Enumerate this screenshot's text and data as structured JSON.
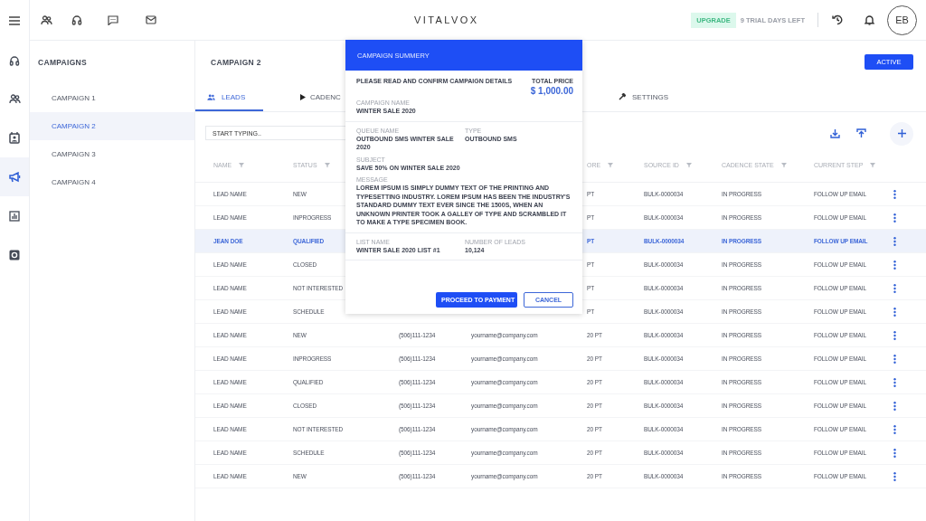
{
  "topbar": {
    "logo": "VITALVOX",
    "upgrade": "UPGRADE",
    "trial": "9 TRIAL DAYS LEFT",
    "avatar": "EB"
  },
  "nav_rail": {
    "items": [
      {
        "selected": false
      },
      {
        "selected": false
      },
      {
        "selected": false
      },
      {
        "selected": true
      },
      {
        "selected": false
      },
      {
        "selected": false
      }
    ]
  },
  "sidebar": {
    "title": "CAMPAIGNS",
    "items": [
      {
        "label": "CAMPAIGN 1",
        "selected": false
      },
      {
        "label": "CAMPAIGN 2",
        "selected": true
      },
      {
        "label": "CAMPAIGN 3",
        "selected": false
      },
      {
        "label": "CAMPAIGN 4",
        "selected": false
      }
    ]
  },
  "main": {
    "title": "CAMPAIGN 2",
    "status_button": "ACTIVE"
  },
  "tabs": [
    {
      "label": "LEADS",
      "selected": true
    },
    {
      "label": "CADENC",
      "selected": false
    },
    {
      "label": "SETTINGS",
      "selected": false
    }
  ],
  "search": {
    "placeholder": "START TYPING.."
  },
  "table": {
    "columns": [
      {
        "label": "NAME"
      },
      {
        "label": "STATUS"
      },
      {},
      {},
      {
        "label": "ORE"
      },
      {
        "label": "SOURCE ID"
      },
      {
        "label": "CADENCE STATE"
      },
      {
        "label": "CURRENT STEP"
      }
    ],
    "rows": [
      {
        "selected": false,
        "cells": [
          "LEAD NAME",
          "NEW",
          null,
          null,
          "PT",
          "BULK-0000034",
          "IN PROGRESS",
          "FOLLOW UP EMAIL"
        ]
      },
      {
        "selected": false,
        "cells": [
          "LEAD NAME",
          "INPROGRESS",
          null,
          null,
          "PT",
          "BULK-0000034",
          "IN PROGRESS",
          "FOLLOW UP EMAIL"
        ]
      },
      {
        "selected": true,
        "cells": [
          "JEAN DOE",
          "QUALIFIED",
          null,
          null,
          "PT",
          "BULK-0000034",
          "IN PROGRESS",
          "FOLLOW UP EMAIL"
        ]
      },
      {
        "selected": false,
        "cells": [
          "LEAD NAME",
          "CLOSED",
          null,
          null,
          "PT",
          "BULK-0000034",
          "IN PROGRESS",
          "FOLLOW UP EMAIL"
        ]
      },
      {
        "selected": false,
        "cells": [
          "LEAD NAME",
          "NOT INTERESTED",
          null,
          null,
          "PT",
          "BULK-0000034",
          "IN PROGRESS",
          "FOLLOW UP EMAIL"
        ]
      },
      {
        "selected": false,
        "cells": [
          "LEAD NAME",
          "SCHEDULE",
          null,
          null,
          "PT",
          "BULK-0000034",
          "IN PROGRESS",
          "FOLLOW UP EMAIL"
        ]
      },
      {
        "selected": false,
        "cells": [
          "LEAD NAME",
          "NEW",
          "(506)111-1234",
          "yourname@company.com",
          "20 PT",
          "BULK-0000034",
          "IN PROGRESS",
          "FOLLOW UP EMAIL"
        ]
      },
      {
        "selected": false,
        "cells": [
          "LEAD NAME",
          "INPROGRESS",
          "(506)111-1234",
          "yourname@company.com",
          "20 PT",
          "BULK-0000034",
          "IN PROGRESS",
          "FOLLOW UP EMAIL"
        ]
      },
      {
        "selected": false,
        "cells": [
          "LEAD NAME",
          "QUALIFIED",
          "(506)111-1234",
          "yourname@company.com",
          "20 PT",
          "BULK-0000034",
          "IN PROGRESS",
          "FOLLOW UP EMAIL"
        ]
      },
      {
        "selected": false,
        "cells": [
          "LEAD NAME",
          "CLOSED",
          "(506)111-1234",
          "yourname@company.com",
          "20 PT",
          "BULK-0000034",
          "IN PROGRESS",
          "FOLLOW UP EMAIL"
        ]
      },
      {
        "selected": false,
        "cells": [
          "LEAD NAME",
          "NOT INTERESTED",
          "(506)111-1234",
          "yourname@company.com",
          "20 PT",
          "BULK-0000034",
          "IN PROGRESS",
          "FOLLOW UP EMAIL"
        ]
      },
      {
        "selected": false,
        "cells": [
          "LEAD NAME",
          "SCHEDULE",
          "(506)111-1234",
          "yourname@company.com",
          "20 PT",
          "BULK-0000034",
          "IN PROGRESS",
          "FOLLOW UP EMAIL"
        ]
      },
      {
        "selected": false,
        "cells": [
          "LEAD NAME",
          "NEW",
          "(506)111-1234",
          "yourname@company.com",
          "20 PT",
          "BULK-0000034",
          "IN PROGRESS",
          "FOLLOW UP EMAIL"
        ]
      }
    ]
  },
  "modal": {
    "title": "CAMPAIGN SUMMERY",
    "intro": "PLEASE READ AND CONFIRM CAMPAIGN DETAILS",
    "price_label": "TOTAL PRICE",
    "price": "$ 1,000.00",
    "sections": [
      [
        {
          "kind": "full",
          "label": "CAMPAIGN NAME",
          "value": "WINTER SALE 2020"
        }
      ],
      [
        {
          "kind": "half",
          "label": "QUEUE NAME",
          "value": "OUTBOUND SMS WINTER SALE  2020"
        },
        {
          "kind": "half",
          "label": "TYPE",
          "value": "OUTBOUND SMS"
        },
        {
          "kind": "full",
          "label": "SUBJECT",
          "value": "SAVE 50% ON WINTER SALE  2020"
        },
        {
          "kind": "full",
          "label": "MESSAGE",
          "value": "LOREM IPSUM IS SIMPLY DUMMY TEXT OF THE PRINTING AND TYPESETTING INDUSTRY. LOREM IPSUM HAS BEEN THE INDUSTRY'S STANDARD DUMMY TEXT EVER SINCE THE 1500S, WHEN AN UNKNOWN PRINTER TOOK A GALLEY OF TYPE AND SCRAMBLED IT TO MAKE A TYPE SPECIMEN BOOK."
        }
      ],
      [
        {
          "kind": "half",
          "label": "LIST NAME",
          "value": "WINTER SALE 2020 LIST #1"
        },
        {
          "kind": "half",
          "label": "NUMBER OF LEADS",
          "value": "10,124"
        }
      ]
    ],
    "primary_button": "PROCEED TO PAYMENT",
    "cancel_button": "CANCEL"
  }
}
